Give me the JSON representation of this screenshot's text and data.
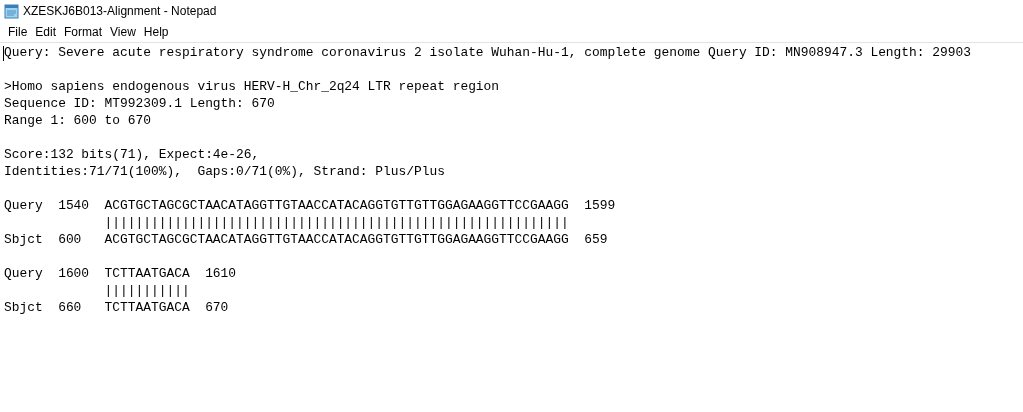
{
  "window": {
    "title": "XZESKJ6B013-Alignment - Notepad"
  },
  "menu": [
    "File",
    "Edit",
    "Format",
    "View",
    "Help"
  ],
  "document": {
    "paragraphs": [
      [
        "Query: Severe acute respiratory syndrome coronavirus 2 isolate Wuhan-Hu-1, complete genome Query ID: MN908947.3 Length: 29903"
      ],
      [
        ">Homo sapiens endogenous virus HERV-H_Chr_2q24 LTR repeat region",
        "Sequence ID: MT992309.1 Length: 670",
        "Range 1: 600 to 670"
      ],
      [
        "Score:132 bits(71), Expect:4e-26,",
        "Identities:71/71(100%),  Gaps:0/71(0%), Strand: Plus/Plus"
      ],
      [
        "Query  1540  ACGTGCTAGCGCTAACATAGGTTGTAACCATACAGGTGTTGTTGGAGAAGGTTCCGAAGG  1599",
        "             ||||||||||||||||||||||||||||||||||||||||||||||||||||||||||||",
        "Sbjct  600   ACGTGCTAGCGCTAACATAGGTTGTAACCATACAGGTGTTGTTGGAGAAGGTTCCGAAGG  659"
      ],
      [
        "Query  1600  TCTTAATGACA  1610",
        "             |||||||||||",
        "Sbjct  660   TCTTAATGACA  670"
      ]
    ]
  }
}
